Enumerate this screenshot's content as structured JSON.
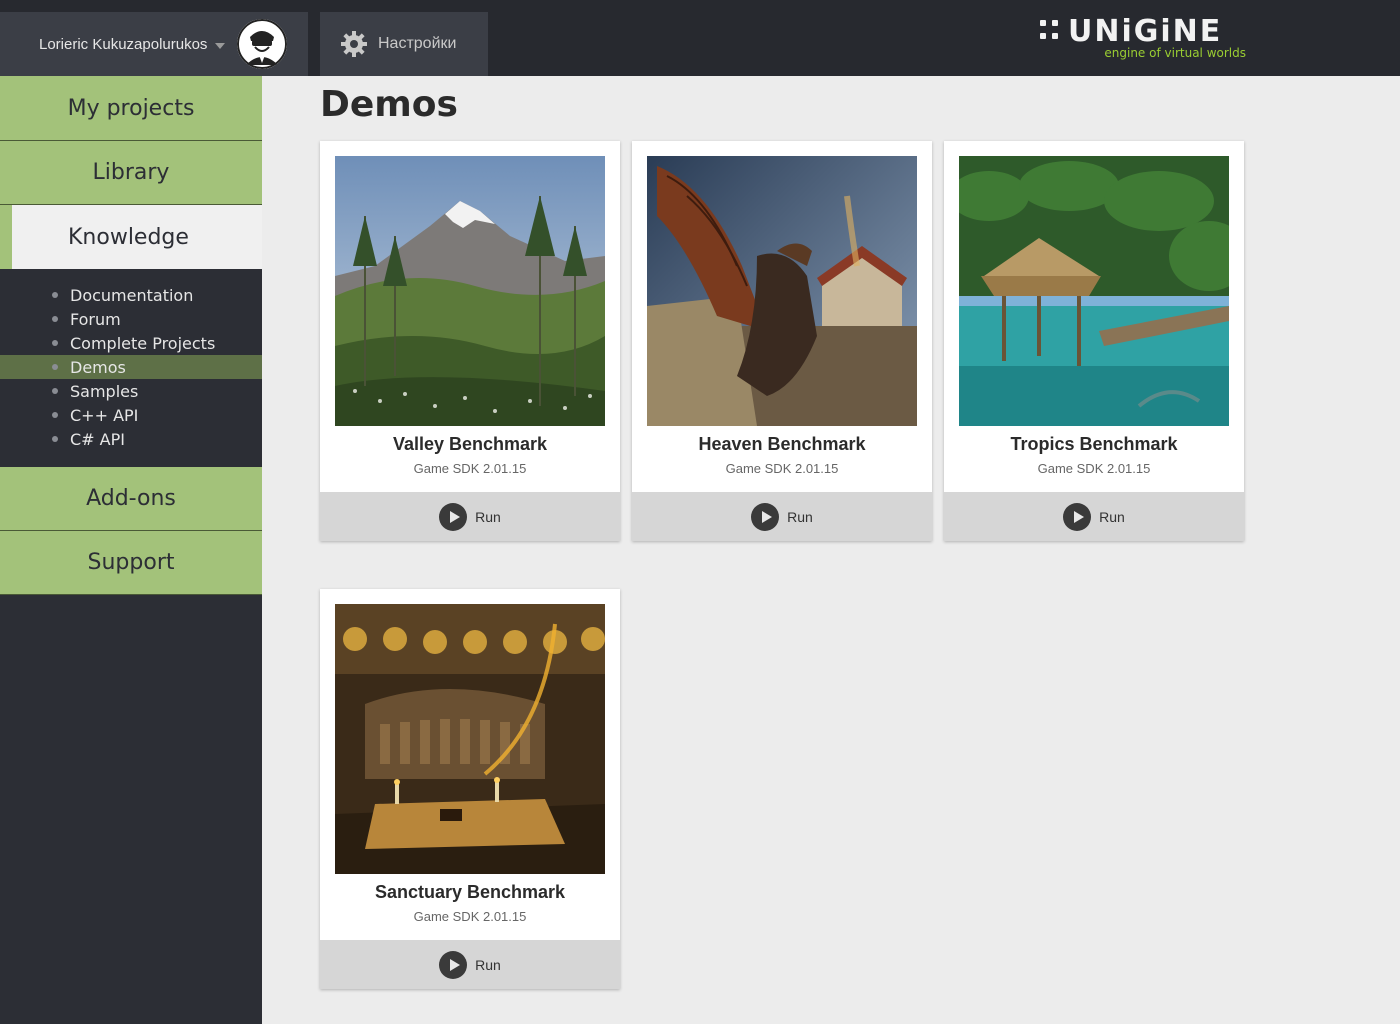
{
  "header": {
    "user_name": "Lorieric Kukuzapolurukos",
    "settings_label": "Настройки",
    "logo_word": "UNiGiNE",
    "logo_tagline": "engine of virtual worlds"
  },
  "sidebar": {
    "my_projects": "My projects",
    "library": "Library",
    "knowledge": "Knowledge",
    "sub_items": [
      "Documentation",
      "Forum",
      "Complete Projects",
      "Demos",
      "Samples",
      "C++ API",
      "C# API"
    ],
    "current_sub": "Demos",
    "addons": "Add-ons",
    "support": "Support"
  },
  "main": {
    "title": "Demos",
    "run_label": "Run",
    "cards": [
      {
        "title": "Valley Benchmark",
        "subtitle": "Game SDK 2.01.15"
      },
      {
        "title": "Heaven Benchmark",
        "subtitle": "Game SDK 2.01.15"
      },
      {
        "title": "Tropics Benchmark",
        "subtitle": "Game SDK 2.01.15"
      },
      {
        "title": "Sanctuary Benchmark",
        "subtitle": "Game SDK 2.01.15"
      }
    ]
  },
  "colors": {
    "accent_green": "#a3c27a",
    "sidebar_dark": "#2c2e35",
    "topbar": "#27292f",
    "logo_tag": "#9acd32"
  },
  "icons": [
    "chevron-down-icon",
    "avatar-icon",
    "gear-icon",
    "play-icon"
  ]
}
